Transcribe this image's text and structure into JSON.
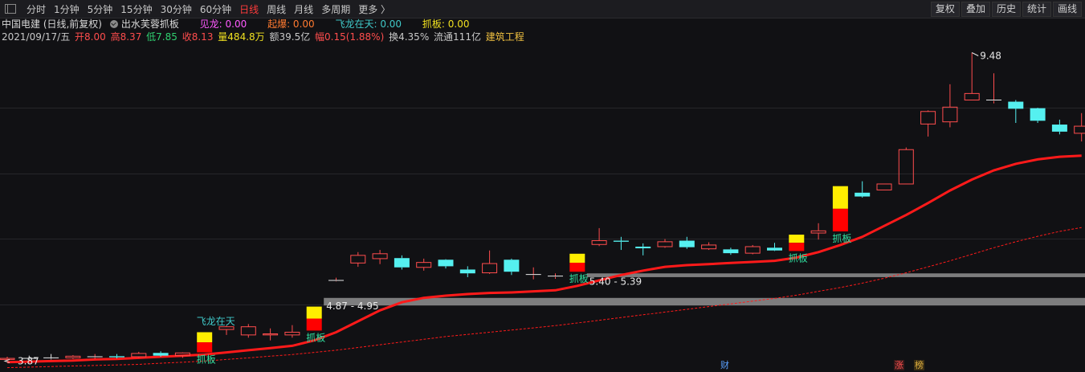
{
  "toolbar": {
    "periods": [
      "分时",
      "1分钟",
      "5分钟",
      "15分钟",
      "30分钟",
      "60分钟",
      "日线",
      "周线",
      "月线",
      "多周期",
      "更多 〉"
    ],
    "active_period": "日线",
    "right_buttons": [
      "复权",
      "叠加",
      "历史",
      "统计",
      "画线"
    ]
  },
  "indicator_bar": {
    "stock": "中国电建 (日线,前复权)",
    "formula": "出水芙蓉抓板",
    "items": [
      {
        "label": "见龙: 0.00",
        "color": "#ff5aff"
      },
      {
        "label": "起爆: 0.00",
        "color": "#ff7a30"
      },
      {
        "label": "飞龙在天: 0.00",
        "color": "#40c8c8"
      },
      {
        "label": "抓板: 0.00",
        "color": "#f0e020"
      }
    ]
  },
  "quote_bar": {
    "date": "2021/09/17/五",
    "open": "开8.00",
    "high": "高8.37",
    "low": "低7.85",
    "close": "收8.13",
    "volume": "量484.8万",
    "amount": "额39.5亿",
    "change": "幅0.15(1.88%)",
    "turnover": "换4.35%",
    "float": "流通111亿",
    "sector": "建筑工程"
  },
  "colors": {
    "up": "#ff4d4d",
    "down": "#55f0f0",
    "ma": "#ff1a1a",
    "zone": "#8a8a8a",
    "signal_yellow": "#ffee00",
    "signal_red": "#ff0000",
    "label_green": "#30e0a0"
  },
  "chart_data": {
    "type": "candlestick",
    "y_axis_visible": false,
    "ylim": [
      3.62,
      9.62
    ],
    "candles": [
      {
        "o": 3.85,
        "h": 3.9,
        "l": 3.82,
        "c": 3.87
      },
      {
        "o": 3.87,
        "h": 3.92,
        "l": 3.84,
        "c": 3.86
      },
      {
        "o": 3.88,
        "h": 3.95,
        "l": 3.85,
        "c": 3.87
      },
      {
        "o": 3.88,
        "h": 3.93,
        "l": 3.86,
        "c": 3.91
      },
      {
        "o": 3.9,
        "h": 3.95,
        "l": 3.86,
        "c": 3.9
      },
      {
        "o": 3.91,
        "h": 3.95,
        "l": 3.87,
        "c": 3.89
      },
      {
        "o": 3.9,
        "h": 3.99,
        "l": 3.88,
        "c": 3.96
      },
      {
        "o": 3.97,
        "h": 4.0,
        "l": 3.9,
        "c": 3.92
      },
      {
        "o": 3.92,
        "h": 3.98,
        "l": 3.88,
        "c": 3.97
      },
      {
        "o": 3.98,
        "h": 4.37,
        "l": 3.98,
        "c": 4.35,
        "signal": true
      },
      {
        "o": 4.4,
        "h": 4.47,
        "l": 4.3,
        "c": 4.45
      },
      {
        "o": 4.3,
        "h": 4.5,
        "l": 4.25,
        "c": 4.45
      },
      {
        "o": 4.3,
        "h": 4.42,
        "l": 4.2,
        "c": 4.32
      },
      {
        "o": 4.3,
        "h": 4.48,
        "l": 4.25,
        "c": 4.35
      },
      {
        "o": 4.38,
        "h": 4.84,
        "l": 4.38,
        "c": 4.82,
        "signal": true
      },
      {
        "o": 5.3,
        "h": 5.35,
        "l": 5.28,
        "c": 5.3
      },
      {
        "o": 5.62,
        "h": 5.82,
        "l": 5.55,
        "c": 5.76
      },
      {
        "o": 5.7,
        "h": 5.86,
        "l": 5.6,
        "c": 5.79
      },
      {
        "o": 5.71,
        "h": 5.76,
        "l": 5.5,
        "c": 5.54
      },
      {
        "o": 5.54,
        "h": 5.7,
        "l": 5.48,
        "c": 5.63
      },
      {
        "o": 5.68,
        "h": 5.69,
        "l": 5.52,
        "c": 5.56
      },
      {
        "o": 5.5,
        "h": 5.56,
        "l": 5.36,
        "c": 5.43
      },
      {
        "o": 5.44,
        "h": 5.85,
        "l": 5.42,
        "c": 5.61
      },
      {
        "o": 5.68,
        "h": 5.7,
        "l": 5.4,
        "c": 5.46
      },
      {
        "o": 5.4,
        "h": 5.54,
        "l": 5.32,
        "c": 5.41
      },
      {
        "o": 5.37,
        "h": 5.43,
        "l": 5.33,
        "c": 5.38
      },
      {
        "o": 5.46,
        "h": 5.81,
        "l": 5.46,
        "c": 5.79,
        "signal": true
      },
      {
        "o": 5.96,
        "h": 6.26,
        "l": 5.93,
        "c": 6.03
      },
      {
        "o": 6.03,
        "h": 6.1,
        "l": 5.86,
        "c": 6.01
      },
      {
        "o": 5.92,
        "h": 5.98,
        "l": 5.76,
        "c": 5.89
      },
      {
        "o": 5.92,
        "h": 6.06,
        "l": 5.9,
        "c": 6.01
      },
      {
        "o": 6.03,
        "h": 6.1,
        "l": 5.88,
        "c": 5.91
      },
      {
        "o": 5.88,
        "h": 6.0,
        "l": 5.86,
        "c": 5.95
      },
      {
        "o": 5.87,
        "h": 5.9,
        "l": 5.77,
        "c": 5.8
      },
      {
        "o": 5.8,
        "h": 5.95,
        "l": 5.78,
        "c": 5.92
      },
      {
        "o": 5.9,
        "h": 5.99,
        "l": 5.84,
        "c": 5.85
      },
      {
        "o": 5.84,
        "h": 6.16,
        "l": 5.84,
        "c": 6.14,
        "signal": true
      },
      {
        "o": 6.17,
        "h": 6.35,
        "l": 6.05,
        "c": 6.21
      },
      {
        "o": 6.2,
        "h": 7.06,
        "l": 6.2,
        "c": 7.03,
        "signal": true
      },
      {
        "o": 6.91,
        "h": 7.12,
        "l": 6.82,
        "c": 6.84
      },
      {
        "o": 6.96,
        "h": 7.07,
        "l": 6.96,
        "c": 7.07
      },
      {
        "o": 7.07,
        "h": 7.74,
        "l": 7.07,
        "c": 7.7
      },
      {
        "o": 8.17,
        "h": 8.42,
        "l": 7.94,
        "c": 8.4
      },
      {
        "o": 8.21,
        "h": 8.9,
        "l": 8.11,
        "c": 8.48
      },
      {
        "o": 8.61,
        "h": 9.48,
        "l": 8.61,
        "c": 8.73
      },
      {
        "o": 8.61,
        "h": 9.1,
        "l": 8.55,
        "c": 8.61
      },
      {
        "o": 8.58,
        "h": 8.61,
        "l": 8.19,
        "c": 8.45
      },
      {
        "o": 8.46,
        "h": 8.47,
        "l": 8.19,
        "c": 8.23
      },
      {
        "o": 8.16,
        "h": 8.25,
        "l": 7.98,
        "c": 8.03
      },
      {
        "o": 8.0,
        "h": 8.37,
        "l": 7.85,
        "c": 8.13
      }
    ],
    "ma_fast": [
      3.8,
      3.81,
      3.82,
      3.83,
      3.85,
      3.86,
      3.88,
      3.9,
      3.92,
      3.94,
      3.98,
      4.02,
      4.06,
      4.1,
      4.2,
      4.35,
      4.55,
      4.75,
      4.9,
      4.98,
      5.02,
      5.05,
      5.07,
      5.08,
      5.1,
      5.12,
      5.2,
      5.3,
      5.4,
      5.48,
      5.55,
      5.58,
      5.6,
      5.62,
      5.64,
      5.66,
      5.72,
      5.82,
      5.95,
      6.1,
      6.3,
      6.5,
      6.72,
      6.95,
      7.15,
      7.32,
      7.44,
      7.52,
      7.57,
      7.59
    ],
    "ma_slow": [
      3.7,
      3.71,
      3.72,
      3.73,
      3.74,
      3.75,
      3.76,
      3.78,
      3.8,
      3.82,
      3.85,
      3.88,
      3.91,
      3.94,
      3.98,
      4.02,
      4.07,
      4.12,
      4.17,
      4.22,
      4.27,
      4.31,
      4.35,
      4.39,
      4.43,
      4.47,
      4.52,
      4.57,
      4.62,
      4.67,
      4.72,
      4.77,
      4.82,
      4.87,
      4.92,
      4.97,
      5.03,
      5.1,
      5.17,
      5.25,
      5.34,
      5.44,
      5.55,
      5.66,
      5.78,
      5.9,
      6.01,
      6.11,
      6.2,
      6.27
    ],
    "zones": [
      {
        "start_index": 14,
        "low": 4.87,
        "high": 4.95,
        "label": "4.87 - 4.95"
      },
      {
        "start_index": 26,
        "low": 5.4,
        "high": 5.39,
        "label": "5.40 - 5.39"
      }
    ],
    "annotations": [
      {
        "index": 9,
        "text": "抓板"
      },
      {
        "index": 9,
        "text": "飞龙在天"
      },
      {
        "index": 14,
        "text": "抓板"
      },
      {
        "index": 26,
        "text": "抓板"
      },
      {
        "index": 36,
        "text": "抓板"
      },
      {
        "index": 38,
        "text": "抓板"
      }
    ],
    "max_label": {
      "index": 44,
      "text": "9.48"
    },
    "min_label": {
      "index": 0,
      "text": "3.87"
    }
  },
  "bottom_tags": [
    {
      "text": "财",
      "color": "#5aa0ff"
    },
    {
      "text": "涨",
      "color": "#ff5050"
    },
    {
      "text": "榜",
      "color": "#e0b040"
    }
  ]
}
